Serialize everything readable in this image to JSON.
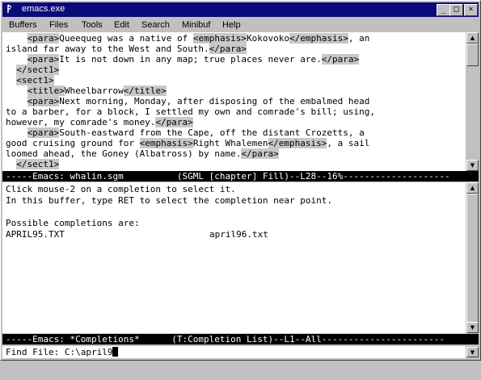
{
  "window": {
    "title": "emacs.exe",
    "minimize_glyph": "_",
    "maximize_glyph": "□",
    "close_glyph": "×"
  },
  "menu": [
    "Buffers",
    "Files",
    "Tools",
    "Edit",
    "Search",
    "Minibuf",
    "Help"
  ],
  "buffer": {
    "lines": [
      [
        {
          "t": "    "
        },
        {
          "t": "<para>",
          "tag": true
        },
        {
          "t": "Queequeg was a native of "
        },
        {
          "t": "<emphasis>",
          "tag": true
        },
        {
          "t": "Kokovoko"
        },
        {
          "t": "</emphasis>",
          "tag": true
        },
        {
          "t": ", an"
        }
      ],
      [
        {
          "t": "island far away to the West and South."
        },
        {
          "t": "</para>",
          "tag": true
        }
      ],
      [
        {
          "t": "    "
        },
        {
          "t": "<para>",
          "tag": true
        },
        {
          "t": "It is not down in any map; true places never are."
        },
        {
          "t": "</para>",
          "tag": true
        }
      ],
      [
        {
          "t": "  "
        },
        {
          "t": "</sect1>",
          "tag": true
        }
      ],
      [
        {
          "t": "  "
        },
        {
          "t": "<sect1>",
          "tag": true
        }
      ],
      [
        {
          "t": "    "
        },
        {
          "t": "<title>",
          "tag": true
        },
        {
          "t": "Wheelbarrow"
        },
        {
          "t": "</title>",
          "tag": true
        }
      ],
      [
        {
          "t": "    "
        },
        {
          "t": "<para>",
          "tag": true
        },
        {
          "t": "Next morning, Monday, after disposing of the embalmed head"
        }
      ],
      [
        {
          "t": "to a barber, for a block, I settled my own and comrade's bill; using,"
        }
      ],
      [
        {
          "t": "however, my comrade's money."
        },
        {
          "t": "</para>",
          "tag": true
        }
      ],
      [
        {
          "t": "    "
        },
        {
          "t": "<para>",
          "tag": true
        },
        {
          "t": "South-eastward from the Cape, off the distant Crozetts, a"
        }
      ],
      [
        {
          "t": "good cruising ground for "
        },
        {
          "t": "<emphasis>",
          "tag": true
        },
        {
          "t": "Right Whalemen"
        },
        {
          "t": "</emphasis>",
          "tag": true
        },
        {
          "t": ", a sail"
        }
      ],
      [
        {
          "t": "loomed ahead, the Goney (Albatross) by name."
        },
        {
          "t": "</para>",
          "tag": true
        }
      ],
      [
        {
          "t": "  "
        },
        {
          "t": "</sect1>",
          "tag": true
        }
      ]
    ]
  },
  "modeline1": "-----Emacs: whalin.sgm          (SGML [chapter] Fill)--L28--16%--------------------",
  "completions": {
    "help1": "Click mouse-2 on a completion to select it.",
    "help2": "In this buffer, type RET to select the completion near point.",
    "possible": "Possible completions are:",
    "items": [
      "APRIL95.TXT",
      "april96.txt"
    ]
  },
  "modeline2": "-----Emacs: *Completions*      (T:Completion List)--L1--All-----------------------",
  "minibuffer": {
    "prompt": "Find File: ",
    "value": "C:\\april9"
  }
}
